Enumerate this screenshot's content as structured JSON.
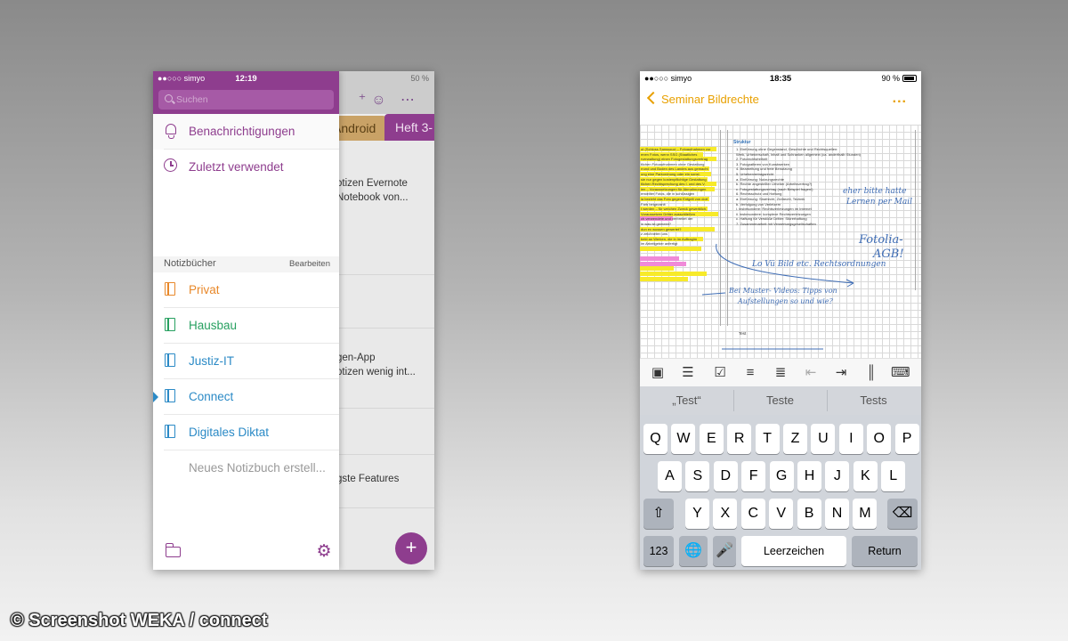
{
  "left_phone": {
    "status": {
      "carrier": "●●○○○ simyo",
      "time": "12:19",
      "battery": "50 %"
    },
    "search": {
      "placeholder": "Suchen"
    },
    "nav": [
      {
        "label": "Benachrichtigungen",
        "icon": "bell-icon"
      },
      {
        "label": "Zuletzt verwendet",
        "icon": "clock-icon"
      }
    ],
    "notebooks_section": {
      "title": "Notizbücher",
      "edit_label": "Bearbeiten"
    },
    "notebooks": [
      {
        "label": "Privat",
        "color": "#e8882a"
      },
      {
        "label": "Hausbau",
        "color": "#27a060"
      },
      {
        "label": "Justiz-IT",
        "color": "#2b8ac6"
      },
      {
        "label": "Connect",
        "color": "#2b8ac6",
        "active": true
      },
      {
        "label": "Digitales Diktat",
        "color": "#2b8ac6"
      }
    ],
    "new_notebook_label": "Neues Notizbuch erstell...",
    "background": {
      "tabs": [
        "Android",
        "Heft 3-"
      ],
      "snippets": [
        [
          "otizen  Evernote",
          "Notebook von..."
        ],
        [
          "gen-App",
          "otizen wenig int..."
        ],
        [
          "gste Features"
        ]
      ],
      "fab_label": "+"
    },
    "accent": "#8e3d8e"
  },
  "right_phone": {
    "status": {
      "carrier": "●●○○○ simyo",
      "time": "18:35",
      "battery": "90 %"
    },
    "nav": {
      "back_label": "Seminar Bildrechte",
      "more_label": "..."
    },
    "doc": {
      "title": "Struktur",
      "left_lines": [
        "ut (Schloss Sanssouci – Fotoaufnahmen zur",
        "enen Fotos, wenn SSG (Staatliches",
        "rverwaltung) einen Fotogestattungsvertrag",
        "",
        "tlichen Fotoaufnahmen ohne Gestattung",
        "rrund und Boden des Landes aus gemacht",
        "ung eine Parkordnung oder ein sonst.",
        "sie nur gegen kostenpflichtige Gestattung",
        "tlichen Rechtsprechung des I. und des V.",
        "",
        "ien – Voraussetzungen für Abmahnungen",
        "",
        "erstellter Fotos, die in schlüssigen",
        "ia bezieht das Foto gegen Entgelt von dort",
        "Farb beigezahlt",
        "",
        "t werden – für welchen Zweck gewerblich,",
        "",
        "Voraussetzen Dritter ausschließen",
        "",
        "ch verwendete und verbreitet der",
        "",
        "in was ist gemeint?",
        "dun ex wussen gewertet?",
        "z zeichneten uns",
        "bekt an Werken, die in im Auftragim",
        "im Arbeitgeber anfertigt"
      ],
      "right_lines": [
        "1.   Einführung ohne Gegenstand, Geschichte und Rechtsquellen:",
        "      Werk, Urheberschaft, Inhalt und Schranken allgemein (ca. anderthalb Stunden)",
        "2.   Fotorechtsfreiheit",
        "3.   Fotografieren von Kunstwerken",
        "4.   Bearbeitung und freie Benutzung",
        "5.   Urhebervertragsrecht",
        "      a.   Einführung: Nutzungsrechte",
        "      b.   Rechte angestellter Urheber (Arbeitsvertrag?)",
        "      c.   Fotogestattungsvertrag (nach Beispiel fragen!)",
        "6.   Rechtsschutz und Haftung",
        "      a.   Einführung: Strafrecht, Zivilrecht, Technik",
        "      b.   Verfolgung von Verletzern",
        "            i.    insbesondere: Rechtsverletzungen im Internet",
        "            ii.   insbesondere: komplexe Rechtsverletzungen",
        "      c.   Haftung für Verstöße Dritter: Störerhaftung",
        "7.   Zusammenarbeit mit Verwertungsgesellschaften"
      ],
      "footer_text": "Test",
      "ink_notes": [
        "eher bitte hatte",
        "Lernen per Mail",
        "Fotolia-",
        "AGB!",
        "Lo Vü Bild etc. Rechtsordnungen",
        "Bei Muster- Videos: Tipps von",
        "Aufstellungen so und wie?"
      ]
    },
    "toolbar_icons": [
      "camera-icon",
      "microphone-icon",
      "checkbox-icon",
      "bullet-list-icon",
      "numbered-list-icon",
      "outdent-icon",
      "indent-icon",
      "format-icon",
      "keyboard-hide-icon"
    ],
    "suggestions": [
      "„Test“",
      "Teste",
      "Tests"
    ],
    "keyboard": {
      "row1": [
        "Q",
        "W",
        "E",
        "R",
        "T",
        "Z",
        "U",
        "I",
        "O",
        "P"
      ],
      "row2": [
        "A",
        "S",
        "D",
        "F",
        "G",
        "H",
        "J",
        "K",
        "L"
      ],
      "row3": [
        "Y",
        "X",
        "C",
        "V",
        "B",
        "N",
        "M"
      ],
      "numbers_label": "123",
      "space_label": "Leerzeichen",
      "return_label": "Return"
    },
    "accent": "#e8a000"
  },
  "watermark": "© Screenshot WEKA / connect"
}
